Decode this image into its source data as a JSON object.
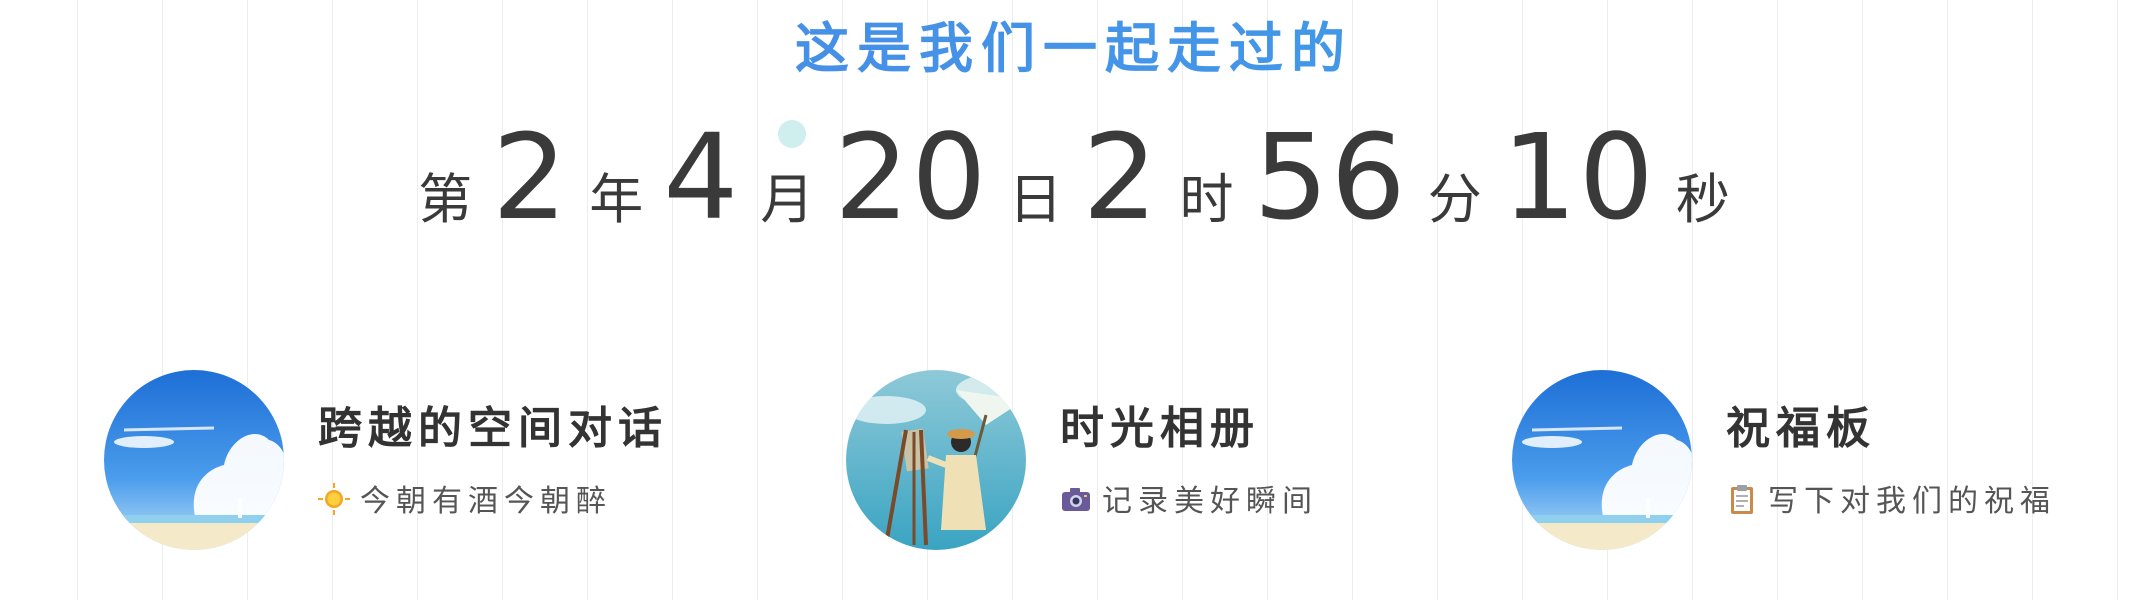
{
  "hero": {
    "title": "这是我们一起走过的"
  },
  "counter": {
    "prefix": "第",
    "years": "2",
    "years_unit": "年",
    "months": "4",
    "months_unit": "月",
    "days": "20",
    "days_unit": "日",
    "hours": "2",
    "hours_unit": "时",
    "minutes": "56",
    "minutes_unit": "分",
    "seconds": "10",
    "seconds_unit": "秒"
  },
  "cards": [
    {
      "title": "跨越的空间对话",
      "subtitle": "今朝有酒今朝醉",
      "icon": "sun-icon"
    },
    {
      "title": "时光相册",
      "subtitle": "记录美好瞬间",
      "icon": "camera-icon"
    },
    {
      "title": "祝福板",
      "subtitle": "写下对我们的祝福",
      "icon": "clipboard-icon"
    }
  ],
  "colors": {
    "title_gradient_start": "#4a84e6",
    "title_gradient_end": "#3ea3e8",
    "counter_text": "#3a3a3a",
    "dot": "#cfeeee"
  }
}
